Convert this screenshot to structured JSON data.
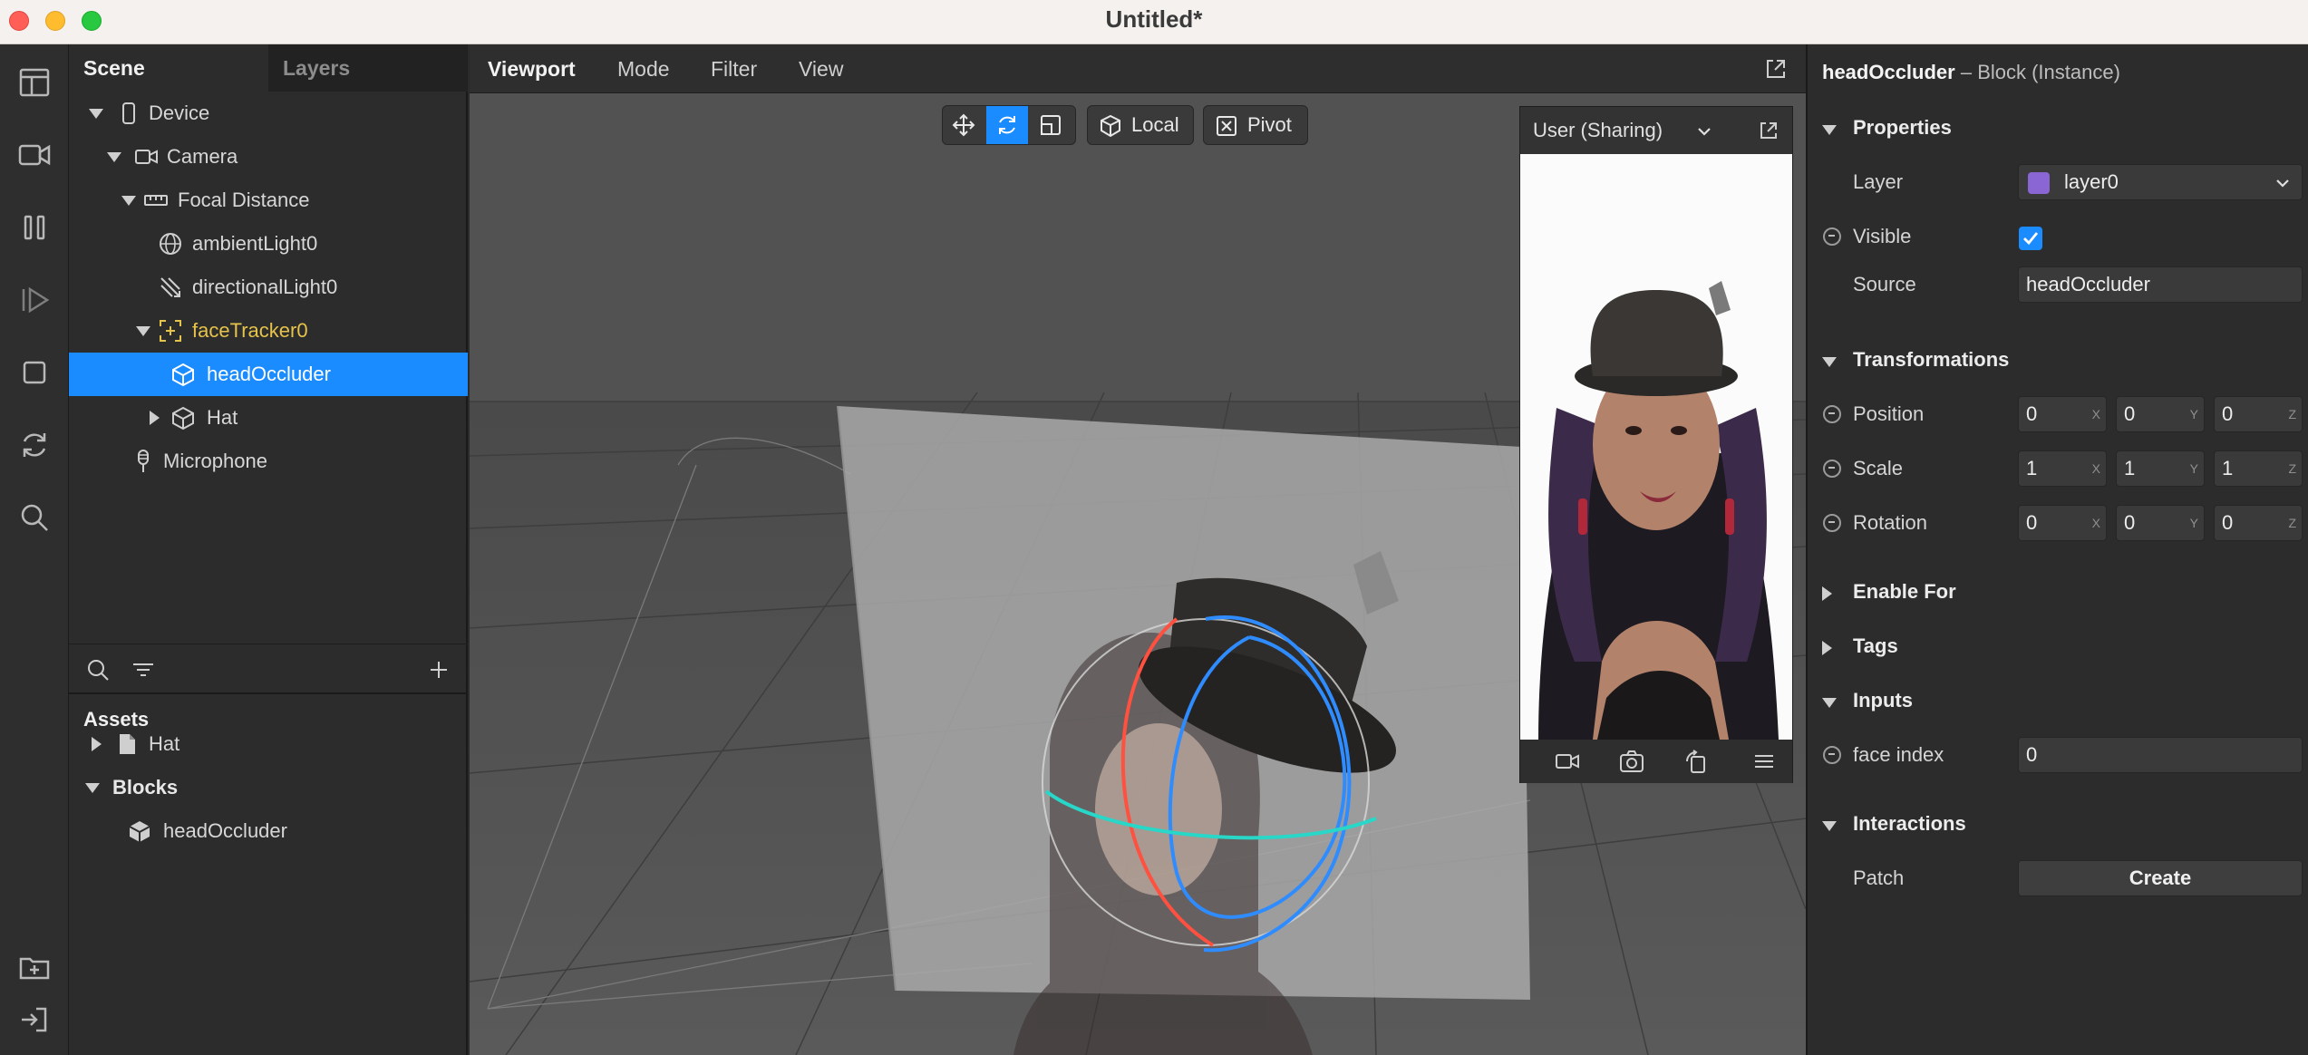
{
  "window": {
    "title": "Untitled*"
  },
  "scene_panel": {
    "tabs": [
      "Scene",
      "Layers"
    ],
    "tree": [
      {
        "label": "Device",
        "icon": "phone-icon"
      },
      {
        "label": "Camera",
        "icon": "camera-icon"
      },
      {
        "label": "Focal Distance",
        "icon": "ruler-icon"
      },
      {
        "label": "ambientLight0",
        "icon": "globe-light-icon"
      },
      {
        "label": "directionalLight0",
        "icon": "directional-light-icon"
      },
      {
        "label": "faceTracker0",
        "icon": "face-tracker-icon"
      },
      {
        "label": "headOccluder",
        "icon": "cube-icon"
      },
      {
        "label": "Hat",
        "icon": "cube-icon"
      },
      {
        "label": "Microphone",
        "icon": "microphone-icon"
      }
    ],
    "selected_item": "headOccluder"
  },
  "assets_panel": {
    "title": "Assets",
    "tree": [
      {
        "label": "Hat",
        "icon": "file-icon"
      },
      {
        "label": "Blocks",
        "icon": ""
      },
      {
        "label": "headOccluder",
        "icon": "block-icon"
      }
    ]
  },
  "viewport": {
    "menu": [
      "Viewport",
      "Mode",
      "Filter",
      "View"
    ],
    "toolbar": {
      "local_label": "Local",
      "pivot_label": "Pivot",
      "active_tool": "rotate"
    }
  },
  "preview": {
    "title": "User (Sharing)"
  },
  "inspector": {
    "object_name": "headOccluder",
    "object_type": "– Block (Instance)",
    "sections": {
      "properties": "Properties",
      "transformations": "Transformations",
      "enable_for": "Enable For",
      "tags": "Tags",
      "inputs": "Inputs",
      "interactions": "Interactions"
    },
    "layer": {
      "label": "Layer",
      "value": "layer0",
      "swatch_color": "#8a66d4"
    },
    "visible": {
      "label": "Visible",
      "checked": true
    },
    "source": {
      "label": "Source",
      "value": "headOccluder"
    },
    "position": {
      "label": "Position",
      "x": "0",
      "y": "0",
      "z": "0"
    },
    "scale": {
      "label": "Scale",
      "x": "1",
      "y": "1",
      "z": "1"
    },
    "rotation": {
      "label": "Rotation",
      "x": "0",
      "y": "0",
      "z": "0"
    },
    "axis_labels": {
      "x": "X",
      "y": "Y",
      "z": "Z"
    },
    "face_index": {
      "label": "face index",
      "value": "0"
    },
    "patch": {
      "label": "Patch",
      "button": "Create"
    }
  },
  "colors": {
    "accent": "#1a8cff",
    "highlight_yellow": "#e6c34a",
    "gizmo_x": "#ff5040",
    "gizmo_y": "#2f8cff",
    "gizmo_z": "#29d7c8"
  }
}
